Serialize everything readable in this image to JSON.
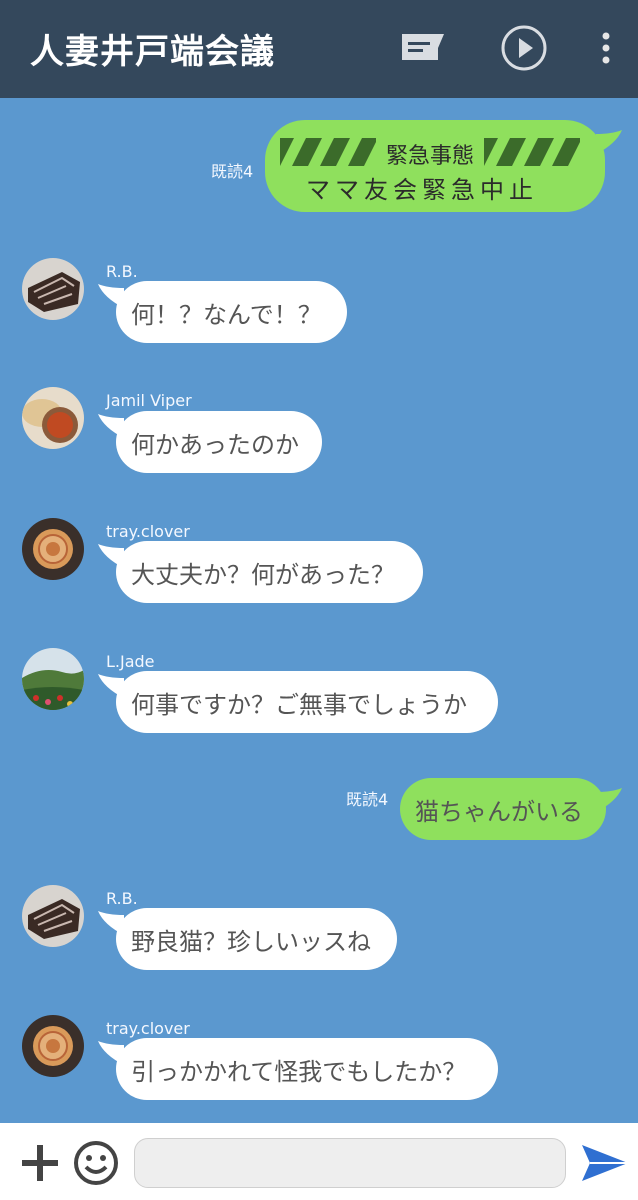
{
  "header": {
    "title": "人妻井戸端会議",
    "icons": [
      "message-icon",
      "play-icon",
      "more-vert-icon"
    ]
  },
  "messages": [
    {
      "type": "outgoing-alert",
      "read": "既読4",
      "alert_title": "緊急事態",
      "text": "ママ友会緊急中止"
    },
    {
      "type": "incoming",
      "sender": "R.B.",
      "text": "何！？なんで！？"
    },
    {
      "type": "incoming",
      "sender": "Jamil Viper",
      "text": "何かあったのか"
    },
    {
      "type": "incoming",
      "sender": "tray.clover",
      "text": "大丈夫か？何があった？"
    },
    {
      "type": "incoming",
      "sender": "L.Jade",
      "text": "何事ですか？ご無事でしょうか"
    },
    {
      "type": "outgoing",
      "read": "既読4",
      "text": "猫ちゃんがいる"
    },
    {
      "type": "incoming",
      "sender": "R.B.",
      "text": "野良猫？珍しいッスね"
    },
    {
      "type": "incoming",
      "sender": "tray.clover",
      "text": "引っかかれて怪我でもしたか？"
    }
  ],
  "footer": {
    "input_value": "",
    "icons": [
      "add-icon",
      "emoji-icon",
      "send-icon"
    ]
  },
  "colors": {
    "header_bg": "#34485c",
    "chat_bg": "#5b98cf",
    "outgoing_bubble": "#8fe05d",
    "incoming_bubble": "#ffffff",
    "send_icon": "#2f6fd1"
  }
}
